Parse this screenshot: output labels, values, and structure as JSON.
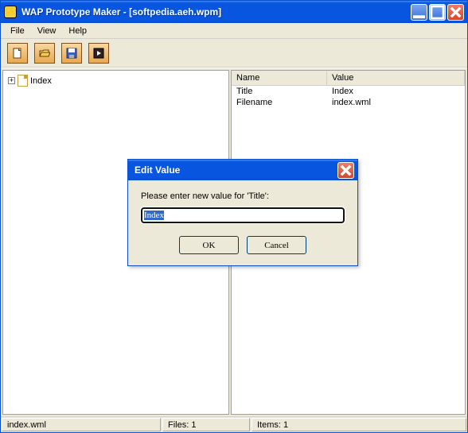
{
  "title": "WAP Prototype Maker - [softpedia.aeh.wpm]",
  "menu": {
    "file": "File",
    "view": "View",
    "help": "Help"
  },
  "toolbar": {
    "new": "New",
    "open": "Open",
    "save": "Save",
    "run": "Run"
  },
  "tree": {
    "root_label": "Index"
  },
  "props": {
    "header_name": "Name",
    "header_value": "Value",
    "rows": [
      {
        "name": "Title",
        "value": "Index"
      },
      {
        "name": "Filename",
        "value": "index.wml"
      }
    ]
  },
  "status": {
    "file": "index.wml",
    "files": "Files: 1",
    "items": "Items: 1"
  },
  "dialog": {
    "title": "Edit Value",
    "prompt": "Please enter new value for 'Title':",
    "value": "Index",
    "ok": "OK",
    "cancel": "Cancel"
  }
}
